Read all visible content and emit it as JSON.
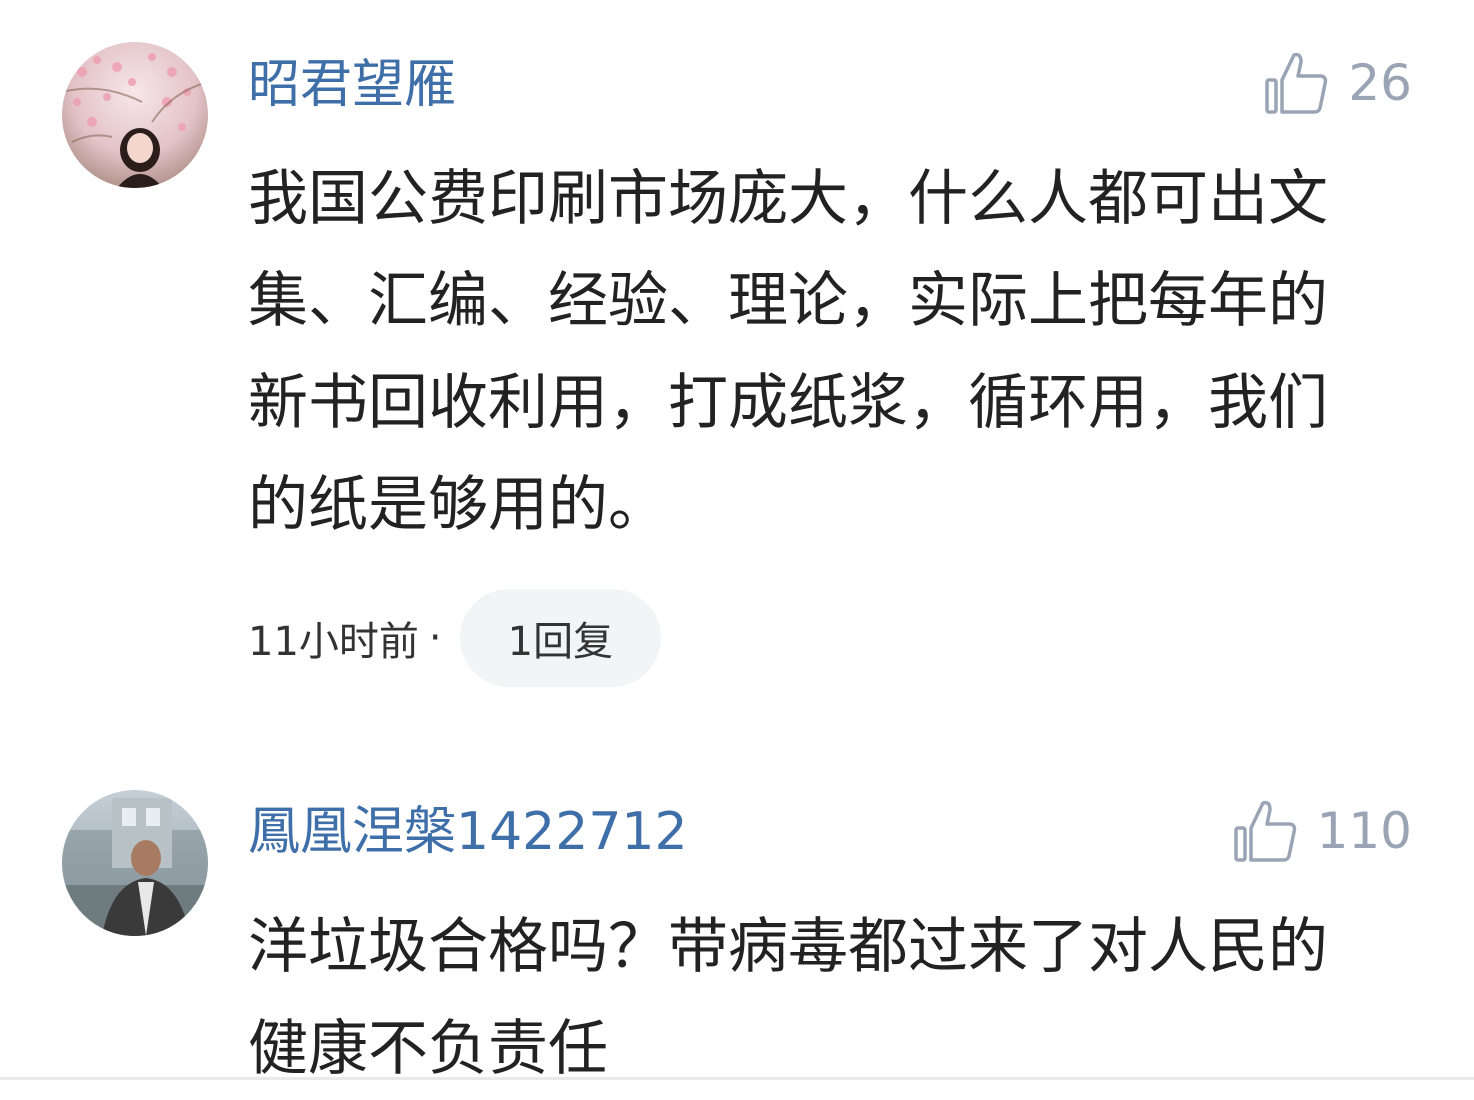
{
  "comments": [
    {
      "username": "昭君望雁",
      "likes": "26",
      "content": "我国公费印刷市场庞大，什么人都可出文集、汇编、经验、理论，实际上把每年的新书回收利用，打成纸浆，循环用，我们的纸是够用的。",
      "time": "11小时前",
      "separator": "·",
      "replies": "1回复"
    },
    {
      "username": "鳳凰涅槃1422712",
      "likes": "110",
      "content": "洋垃圾合格吗？带病毒都过来了对人民的健康不负责任"
    }
  ],
  "colors": {
    "username": "#3f6fa8",
    "like": "#9aa4b5",
    "text": "#222222",
    "pill": "#f3f4f6"
  },
  "icons": {
    "like": "thumbs-up-icon"
  }
}
